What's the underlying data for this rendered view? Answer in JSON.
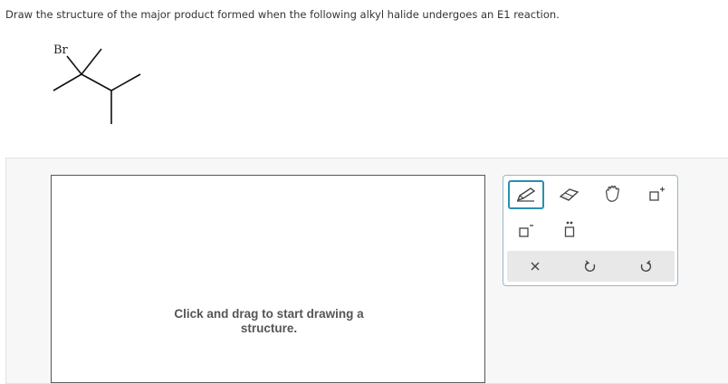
{
  "question": {
    "text": "Draw the structure of the major product formed when the following alkyl halide undergoes an E1 reaction."
  },
  "molecule": {
    "halogen_label": "Br"
  },
  "canvas": {
    "hint_line1": "Click and drag to start drawing a",
    "hint_line2": "structure."
  },
  "toolbox": {
    "tools": [
      "pencil-icon",
      "eraser-icon",
      "hand-drag-icon",
      "add-charge-icon",
      "subtract-charge-icon",
      "lone-pair-icon"
    ],
    "actions": [
      "clear-x-icon",
      "undo-icon",
      "redo-icon"
    ],
    "active_tool": "pencil-icon",
    "accent_color": "#2a8fb0"
  }
}
